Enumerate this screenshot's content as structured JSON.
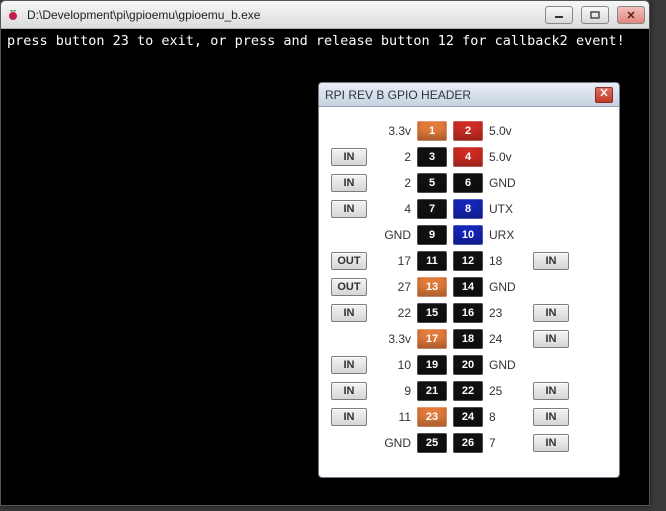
{
  "window": {
    "title": "D:\\Development\\pi\\gpioemu\\gpioemu_b.exe",
    "console_text": "press button 23 to exit, or press and release button 12 for callback2 event!"
  },
  "gpio": {
    "title": "RPI REV B GPIO HEADER",
    "rows": [
      {
        "ioL": "",
        "labL": "3.3v",
        "pinL": {
          "n": "1",
          "c": "orange"
        },
        "pinR": {
          "n": "2",
          "c": "red"
        },
        "labR": "5.0v",
        "ioR": ""
      },
      {
        "ioL": "IN",
        "labL": "2",
        "pinL": {
          "n": "3",
          "c": "black"
        },
        "pinR": {
          "n": "4",
          "c": "red"
        },
        "labR": "5.0v",
        "ioR": ""
      },
      {
        "ioL": "IN",
        "labL": "2",
        "pinL": {
          "n": "5",
          "c": "black"
        },
        "pinR": {
          "n": "6",
          "c": "black"
        },
        "labR": "GND",
        "ioR": ""
      },
      {
        "ioL": "IN",
        "labL": "4",
        "pinL": {
          "n": "7",
          "c": "black"
        },
        "pinR": {
          "n": "8",
          "c": "blue"
        },
        "labR": "UTX",
        "ioR": ""
      },
      {
        "ioL": "",
        "labL": "GND",
        "pinL": {
          "n": "9",
          "c": "black"
        },
        "pinR": {
          "n": "10",
          "c": "blue"
        },
        "labR": "URX",
        "ioR": ""
      },
      {
        "ioL": "OUT",
        "labL": "17",
        "pinL": {
          "n": "11",
          "c": "black"
        },
        "pinR": {
          "n": "12",
          "c": "black"
        },
        "labR": "18",
        "ioR": "IN"
      },
      {
        "ioL": "OUT",
        "labL": "27",
        "pinL": {
          "n": "13",
          "c": "orange"
        },
        "pinR": {
          "n": "14",
          "c": "black"
        },
        "labR": "GND",
        "ioR": ""
      },
      {
        "ioL": "IN",
        "labL": "22",
        "pinL": {
          "n": "15",
          "c": "black"
        },
        "pinR": {
          "n": "16",
          "c": "black"
        },
        "labR": "23",
        "ioR": "IN"
      },
      {
        "ioL": "",
        "labL": "3.3v",
        "pinL": {
          "n": "17",
          "c": "orange"
        },
        "pinR": {
          "n": "18",
          "c": "black"
        },
        "labR": "24",
        "ioR": "IN"
      },
      {
        "ioL": "IN",
        "labL": "10",
        "pinL": {
          "n": "19",
          "c": "black"
        },
        "pinR": {
          "n": "20",
          "c": "black"
        },
        "labR": "GND",
        "ioR": ""
      },
      {
        "ioL": "IN",
        "labL": "9",
        "pinL": {
          "n": "21",
          "c": "black"
        },
        "pinR": {
          "n": "22",
          "c": "black"
        },
        "labR": "25",
        "ioR": "IN"
      },
      {
        "ioL": "IN",
        "labL": "11",
        "pinL": {
          "n": "23",
          "c": "orange"
        },
        "pinR": {
          "n": "24",
          "c": "black"
        },
        "labR": "8",
        "ioR": "IN"
      },
      {
        "ioL": "",
        "labL": "GND",
        "pinL": {
          "n": "25",
          "c": "black"
        },
        "pinR": {
          "n": "26",
          "c": "black"
        },
        "labR": "7",
        "ioR": "IN"
      }
    ]
  }
}
